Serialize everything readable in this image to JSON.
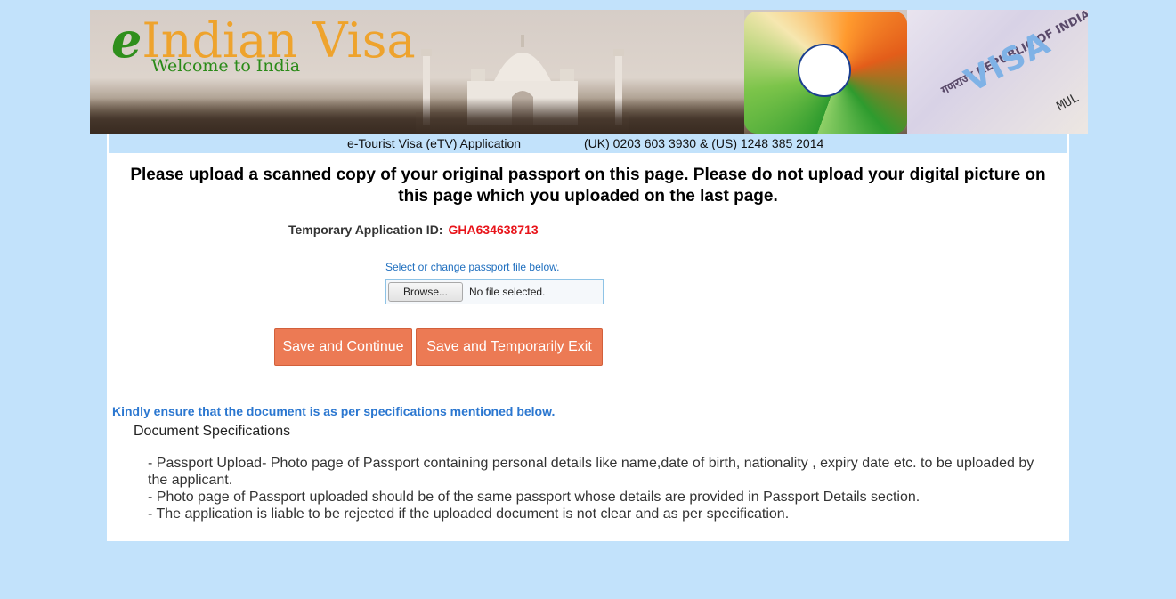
{
  "banner": {
    "brand_e": "e",
    "brand_rest": "Indian Visa",
    "tagline": "Welcome to India",
    "visa_stamp_text": "VISA",
    "visa_republic_text": "गणराज्य REPUBLIC OF INDIA",
    "visa_mul_text": "MUL"
  },
  "infobar": {
    "left": "e-Tourist Visa (eTV) Application",
    "right": "(UK) 0203 603 3930 & (US) 1248 385 2014"
  },
  "heading": "Please upload a scanned copy of your original passport on this page. Please do not upload your digital picture on this page which you uploaded on the last page.",
  "temp_application": {
    "label": "Temporary Application ID:",
    "value": "GHA634638713",
    "value_color": "#e8141a"
  },
  "upload": {
    "hint": "Select or change passport file below.",
    "browse_label": "Browse...",
    "status": "No file selected."
  },
  "buttons": {
    "save_continue": "Save and Continue",
    "save_exit": "Save and Temporarily Exit",
    "color": "#ec7a54"
  },
  "notice": "Kindly ensure that the document is as per specifications mentioned below.",
  "specs": {
    "title": "Document Specifications",
    "items": [
      "- Passport Upload- Photo page of Passport containing personal details like name,date of birth, nationality , expiry date etc. to be uploaded by the applicant.",
      "- Photo page of Passport uploaded should be of the same passport whose details are provided in Passport Details section.",
      "- The application is liable to be rejected if the uploaded document is not clear and as per specification."
    ]
  },
  "colors": {
    "page_background": "#c2e2fb",
    "panel_background": "#ffffff",
    "notice_blue": "#2b77d0"
  }
}
